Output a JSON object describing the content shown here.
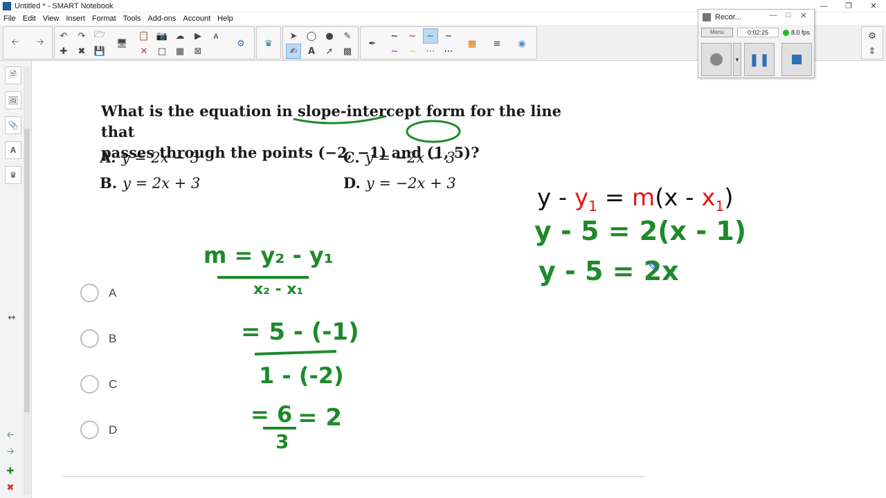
{
  "window": {
    "title": "Untitled * - SMART Notebook"
  },
  "menu": [
    "File",
    "Edit",
    "View",
    "Insert",
    "Format",
    "Tools",
    "Add-ons",
    "Account",
    "Help"
  ],
  "question": {
    "line1": "What is the equation in slope-intercept form for the line that",
    "line2": "passes through the points (−2, −1) and (1, 5)?"
  },
  "answers": [
    {
      "letter": "A.",
      "text": "y = 2x − 3"
    },
    {
      "letter": "C.",
      "text": "y = −2x − 3"
    },
    {
      "letter": "B.",
      "text": "y = 2x + 3"
    },
    {
      "letter": "D.",
      "text": "y = −2x + 3"
    }
  ],
  "options": [
    "A",
    "B",
    "C",
    "D"
  ],
  "handwriting": {
    "slope_formula_num": "m = y₂ - y₁",
    "slope_formula_den": "x₂ - x₁",
    "sub_num": "= 5 - (-1)",
    "sub_den": "1 - (-2)",
    "result_num": "= 6",
    "result_den": "3",
    "result_eq": "= 2",
    "pt_form_1": "y - 5 = 2(x - 1)",
    "pt_form_2": "y - 5 = 2x"
  },
  "point_slope_formula": {
    "y": "y",
    "minus1": " - ",
    "y1": "y",
    "y1_sub": "1",
    "eq": " = ",
    "m": "m",
    "open": "(x - ",
    "x1": "x",
    "x1_sub": "1",
    "close": ")"
  },
  "recorder": {
    "title": "Recor...",
    "menu": "Menu",
    "time": "0:02:25",
    "fps": "8.0 fps"
  },
  "colors": {
    "ink_green": "#1e8a2a",
    "formula_red": "#e01919",
    "highlight_blue": "#bcd8f2"
  }
}
